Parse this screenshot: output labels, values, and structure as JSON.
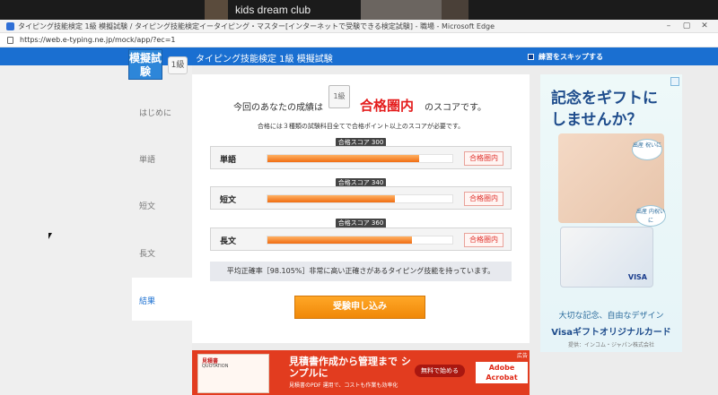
{
  "meeting": {
    "participant_name": "kids dream club"
  },
  "browser": {
    "window_title": "タイピング技能検定 1級 模擬試験 / タイピング技能検定イータイピング・マスター[インターネットで受験できる検定試験] - 職場 - Microsoft Edge",
    "url": "https://web.e-typing.ne.jp/mock/app/?ec=1",
    "window_controls": {
      "minimize": "–",
      "maximize": "▢",
      "close": "✕"
    }
  },
  "header": {
    "title": "タイピング技能検定 1級 模擬試験",
    "skip_label": "練習をスキップする",
    "badge_text": "模擬試験",
    "level_badge": "1級"
  },
  "sidebar": {
    "items": [
      "はじめに",
      "単語",
      "短文",
      "長文",
      "結果"
    ],
    "active_index": 4
  },
  "result": {
    "prefix": "今回のあなたの成績は",
    "grade_icon": "1級",
    "grade": "合格圏内",
    "suffix": "のスコアです。",
    "requirement": "合格には３種類の試験科目全てで合格ポイント以上のスコアが必要です。",
    "rows": [
      {
        "label": "単語",
        "pass_tag": "合格スコア 300",
        "fill_fraction": 0.82,
        "result": "合格圏内"
      },
      {
        "label": "短文",
        "pass_tag": "合格スコア 340",
        "fill_fraction": 0.69,
        "result": "合格圏内"
      },
      {
        "label": "長文",
        "pass_tag": "合格スコア 360",
        "fill_fraction": 0.78,
        "result": "合格圏内"
      }
    ],
    "accuracy": "平均正確率［98.105%］非常に高い正確さがあるタイピング技能を持っています。",
    "start_button": "受験申し込み"
  },
  "ad_right": {
    "headline_1": "記念をギフトに",
    "headline_2": "しませんか？",
    "bubble_1": "出産 祝いに",
    "bubble_2": "出産 内祝いに",
    "card_brand": "VISA",
    "tagline": "大切な記念、自由なデザイン",
    "product": "Visaギフトオリジナルカード",
    "footer": "提供：インコム・ジャパン株式会社"
  },
  "ad_bottom": {
    "doc_title": "見積書",
    "doc_sub": "QUOTATION",
    "main_text": "見積書作成から管理まで シンプルに",
    "sub_text": "見積書のPDF 運用で、コストも作業も効率化",
    "cta": "無料で始める",
    "brand": "Adobe Acrobat",
    "label": "広告"
  }
}
